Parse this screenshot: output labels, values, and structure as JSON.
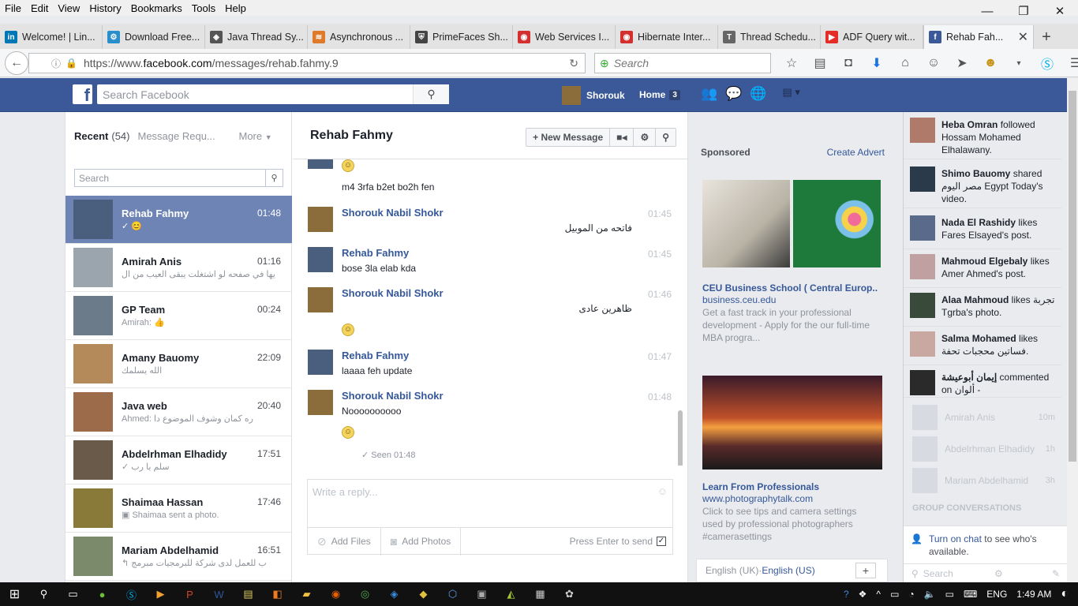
{
  "menu": [
    "File",
    "Edit",
    "View",
    "History",
    "Bookmarks",
    "Tools",
    "Help"
  ],
  "window_controls": {
    "minimize": "—",
    "restore": "❐",
    "close": "✕"
  },
  "tabs": [
    {
      "label": "Welcome! | Lin...",
      "fav": "in",
      "color": "#0077b5"
    },
    {
      "label": "Download Free...",
      "fav": "⚙",
      "color": "#2b8ecc"
    },
    {
      "label": "Java Thread Sy...",
      "fav": "◈",
      "color": "#555555"
    },
    {
      "label": "Asynchronous ...",
      "fav": "≋",
      "color": "#e07a2b"
    },
    {
      "label": "PrimeFaces Sh...",
      "fav": "⛨",
      "color": "#444444"
    },
    {
      "label": "Web Services I...",
      "fav": "◉",
      "color": "#d32f2f"
    },
    {
      "label": "Hibernate Inter...",
      "fav": "◉",
      "color": "#d32f2f"
    },
    {
      "label": "Thread Schedu...",
      "fav": "T",
      "color": "#666666"
    },
    {
      "label": "ADF Query wit...",
      "fav": "▶",
      "color": "#e52d27"
    },
    {
      "label": "Rehab Fah...",
      "fav": "f",
      "color": "#3b5998"
    }
  ],
  "url": {
    "prefix": "https://www.",
    "host": "facebook.com",
    "path": "/messages/rehab.fahmy.9"
  },
  "browser_search_placeholder": "Search",
  "fb": {
    "search_placeholder": "Search Facebook",
    "user": "Shorouk",
    "home_label": "Home",
    "home_count": "3"
  },
  "inbox": {
    "recent_label": "Recent",
    "recent_count": "(54)",
    "requests_label": "Message Requ...",
    "more_label": "More",
    "search_placeholder": "Search"
  },
  "conversations": [
    {
      "name": "Rehab Fahmy",
      "time": "01:48",
      "snippet": "✓ 😊",
      "selected": true,
      "color": "#4a5f7e"
    },
    {
      "name": "Amirah Anis",
      "time": "01:16",
      "snippet": "يها في صفحه لو اشتغلت يبقى العيب من ال",
      "selected": false,
      "color": "#9aa5ad"
    },
    {
      "name": "GP Team",
      "time": "00:24",
      "snippet": "Amirah: 👍",
      "selected": false,
      "color": "#6b7b8a"
    },
    {
      "name": "Amany Bauomy",
      "time": "22:09",
      "snippet": "الله يسلمك",
      "selected": false,
      "color": "#b58a5a"
    },
    {
      "name": "Java web",
      "time": "20:40",
      "snippet": "Ahmed: ره كمان وشوف الموضوع دا",
      "selected": false,
      "color": "#9b6b4a"
    },
    {
      "name": "Abdelrhman Elhadidy",
      "time": "17:51",
      "snippet": "✓ سلم يا رب",
      "selected": false,
      "color": "#6a5a4a"
    },
    {
      "name": "Shaimaa Hassan",
      "time": "17:46",
      "snippet": "▣ Shaimaa sent a photo.",
      "selected": false,
      "color": "#8a7a3a"
    },
    {
      "name": "Mariam Abdelhamid",
      "time": "16:51",
      "snippet": "↰ ب للعمل لدى شركة للبرمجيات مبرمج",
      "selected": false,
      "color": "#7a8a6a"
    }
  ],
  "chat": {
    "title": "Rehab Fahmy",
    "new_message": "+ New Message",
    "messages": {
      "m0": "m4 3rfa b2et bo2h fen",
      "a1": "Shorouk Nabil Shokr",
      "t1": "01:45",
      "m1": "فاتحه من الموبيل",
      "a2": "Rehab Fahmy",
      "t2": "01:45",
      "m2": "bose 3la elab kda",
      "a3": "Shorouk Nabil Shokr",
      "t3": "01:46",
      "m3": "ظاهرين عادى",
      "a4": "Rehab Fahmy",
      "t4": "01:47",
      "m4": "laaaa feh update",
      "a5": "Shorouk Nabil Shokr",
      "t5": "01:48",
      "m5": "Noooooooooo"
    },
    "seen": "✓ Seen 01:48",
    "reply_placeholder": "Write a reply...",
    "add_files": "Add Files",
    "add_photos": "Add Photos",
    "press_enter": "Press Enter to send"
  },
  "ads": {
    "sponsored": "Sponsored",
    "create_advert": "Create Advert",
    "ad1": {
      "title": "CEU Business School ( Central Europ...",
      "domain": "business.ceu.edu",
      "desc": "Get a fast track in your professional development - Apply for the our full-time MBA progra..."
    },
    "ad2": {
      "title": "Learn From Professionals",
      "domain": "www.photographytalk.com",
      "desc": "Click to see tips and camera settings used by professional photographers #camerasettings"
    }
  },
  "language": {
    "uk": "English (UK)",
    "sep": " · ",
    "us": "English (US)"
  },
  "ticker": [
    {
      "b": "Heba Omran",
      "r": " followed Hossam Mohamed Elhalawany.",
      "color": "#b07a6a"
    },
    {
      "b": "Shimo Bauomy",
      "r": " shared مصر اليوم Egypt Today's video.",
      "color": "#2a3a4a"
    },
    {
      "b": "Nada El Rashidy",
      "r": " likes Fares Elsayed's post.",
      "color": "#5a6a8a"
    },
    {
      "b": "Mahmoud Elgebaly",
      "r": " likes Amer Ahmed's post.",
      "color": "#c0a0a0"
    },
    {
      "b": "Alaa Mahmoud",
      "r": " likes تجربة Tgrba's photo.",
      "color": "#3a4a3a"
    },
    {
      "b": "Salma Mohamed",
      "r": " likes فساتين محجبات تحفة.",
      "color": "#c8a8a0"
    },
    {
      "b": "إيمان أبوعيشة",
      "r": " commented on ألوان -",
      "color": "#2a2a2a"
    }
  ],
  "chat_users": [
    {
      "name": "Amirah Anis",
      "time": "10m"
    },
    {
      "name": "Abdelrhman Elhadidy",
      "time": "1h"
    },
    {
      "name": "Mariam Abdelhamid",
      "time": "3h"
    }
  ],
  "group_conversations": "GROUP CONVERSATIONS",
  "turn_on": {
    "link": "Turn on chat",
    "rest": " to see who's available."
  },
  "chat_search_placeholder": "Search",
  "tray": {
    "lang": "ENG",
    "time": "1:49 AM"
  }
}
